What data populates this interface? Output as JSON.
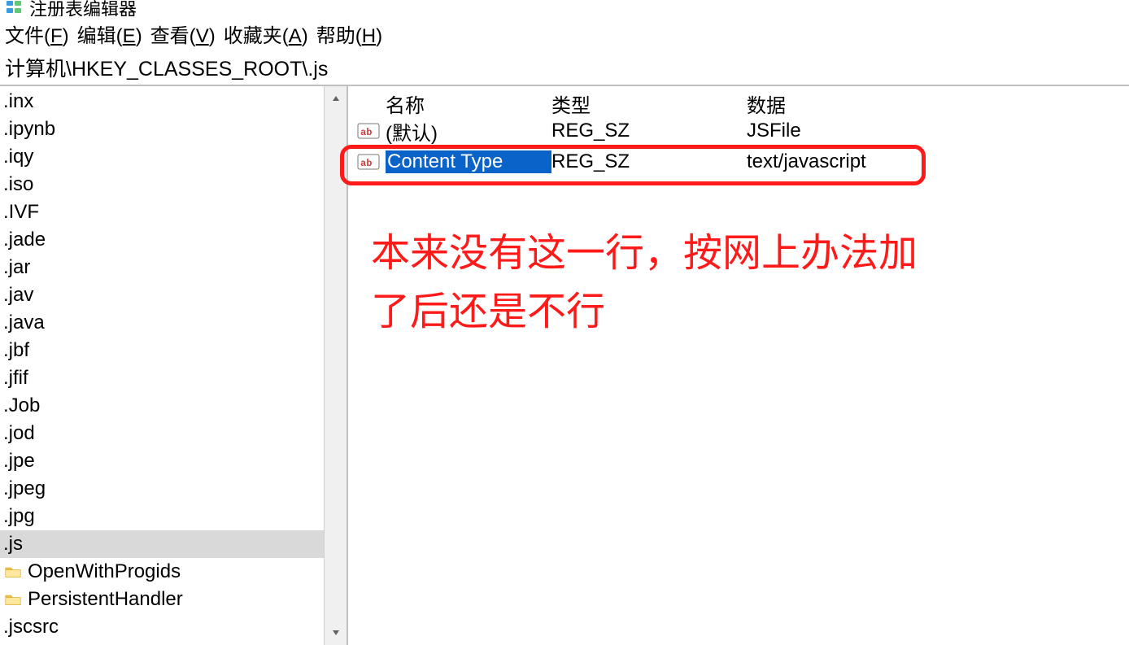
{
  "app": {
    "title": "注册表编辑器"
  },
  "menu": {
    "file_prefix": "文件(",
    "file_key": "F",
    "file_suffix": ")",
    "edit_prefix": "编辑(",
    "edit_key": "E",
    "edit_suffix": ")",
    "view_prefix": "查看(",
    "view_key": "V",
    "view_suffix": ")",
    "fav_prefix": "收藏夹(",
    "fav_key": "A",
    "fav_suffix": ")",
    "help_prefix": "帮助(",
    "help_key": "H",
    "help_suffix": ")"
  },
  "address": {
    "path": "计算机\\HKEY_CLASSES_ROOT\\.js"
  },
  "tree": {
    "items": [
      {
        "name": ".inx",
        "folder": false,
        "indent": 0
      },
      {
        "name": ".ipynb",
        "folder": false,
        "indent": 0
      },
      {
        "name": ".iqy",
        "folder": false,
        "indent": 0
      },
      {
        "name": ".iso",
        "folder": false,
        "indent": 0
      },
      {
        "name": ".IVF",
        "folder": false,
        "indent": 0
      },
      {
        "name": ".jade",
        "folder": false,
        "indent": 0
      },
      {
        "name": ".jar",
        "folder": false,
        "indent": 0
      },
      {
        "name": ".jav",
        "folder": false,
        "indent": 0
      },
      {
        "name": ".java",
        "folder": false,
        "indent": 0
      },
      {
        "name": ".jbf",
        "folder": false,
        "indent": 0
      },
      {
        "name": ".jfif",
        "folder": false,
        "indent": 0
      },
      {
        "name": ".Job",
        "folder": false,
        "indent": 0
      },
      {
        "name": ".jod",
        "folder": false,
        "indent": 0
      },
      {
        "name": ".jpe",
        "folder": false,
        "indent": 0
      },
      {
        "name": ".jpeg",
        "folder": false,
        "indent": 0
      },
      {
        "name": ".jpg",
        "folder": false,
        "indent": 0
      },
      {
        "name": ".js",
        "folder": false,
        "indent": 0,
        "selected": true
      },
      {
        "name": "OpenWithProgids",
        "folder": true,
        "indent": 1
      },
      {
        "name": "PersistentHandler",
        "folder": true,
        "indent": 1
      },
      {
        "name": ".jscsrc",
        "folder": false,
        "indent": 0
      }
    ]
  },
  "values": {
    "headers": {
      "name": "名称",
      "type": "类型",
      "data": "数据"
    },
    "rows": [
      {
        "name": "(默认)",
        "type": "REG_SZ",
        "data": "JSFile",
        "selected": false
      },
      {
        "name": "Content Type",
        "type": "REG_SZ",
        "data": "text/javascript",
        "selected": true
      }
    ]
  },
  "annotation": {
    "line1": "本来没有这一行，按网上办法加",
    "line2": "了后还是不行"
  }
}
